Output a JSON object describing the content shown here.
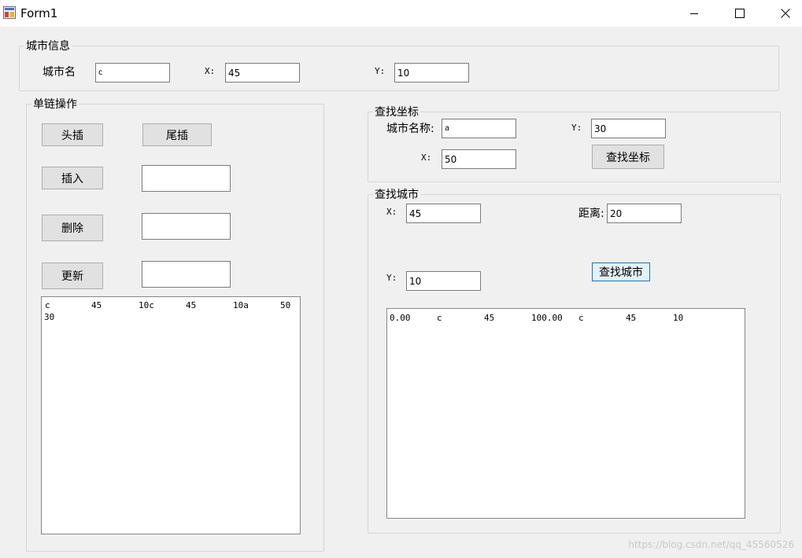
{
  "window": {
    "title": "Form1"
  },
  "city_info": {
    "legend": "城市信息",
    "name_label": "城市名",
    "name_value": "c",
    "x_label": "X:",
    "x_value": "45",
    "y_label": "Y:",
    "y_value": "10"
  },
  "list_ops": {
    "legend": "单链操作",
    "head_insert": "头插",
    "tail_insert": "尾插",
    "insert": "插入",
    "delete": "删除",
    "update": "更新",
    "insert_value": "",
    "delete_value": "",
    "update_value": "",
    "list_line1": [
      "c",
      "45",
      "10c",
      "45",
      "10a",
      "50"
    ],
    "list_line2": "30"
  },
  "find_coord": {
    "legend": "查找坐标",
    "name_label": "城市名称:",
    "name_value": "a",
    "y_label": "Y:",
    "y_value": "30",
    "x_label": "X:",
    "x_value": "50",
    "button": "查找坐标"
  },
  "find_city": {
    "legend": "查找城市",
    "x_label": "X:",
    "x_value": "45",
    "dist_label": "距离:",
    "dist_value": "20",
    "y_label": "Y:",
    "y_value": "10",
    "button": "查找城市",
    "result_line": [
      "0.00",
      "c",
      "45",
      "100.00",
      "c",
      "45",
      "10"
    ]
  },
  "watermark": "https://blog.csdn.net/qq_45560526"
}
